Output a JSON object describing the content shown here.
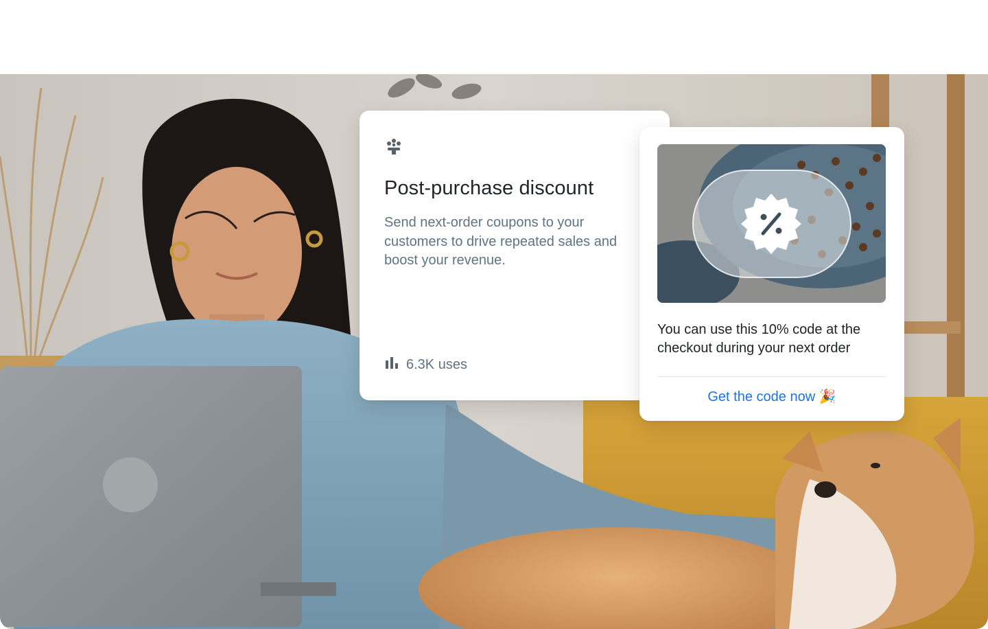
{
  "discount_card": {
    "icon": "gift-flower-icon",
    "title": "Post-purchase discount",
    "description": "Send next-order coupons to your customers to drive repeated sales and boost your revenue.",
    "usage_icon": "bar-chart-icon",
    "usage_text": "6.3K uses"
  },
  "coupon_card": {
    "badge_icon": "percent-badge-icon",
    "message": "You can use this 10% code at the checkout during your next order",
    "cta_label": "Get the code now",
    "cta_emoji": "🎉"
  },
  "colors": {
    "accent": "#1a73e8",
    "title": "#1e2427",
    "muted": "#5f7483"
  }
}
